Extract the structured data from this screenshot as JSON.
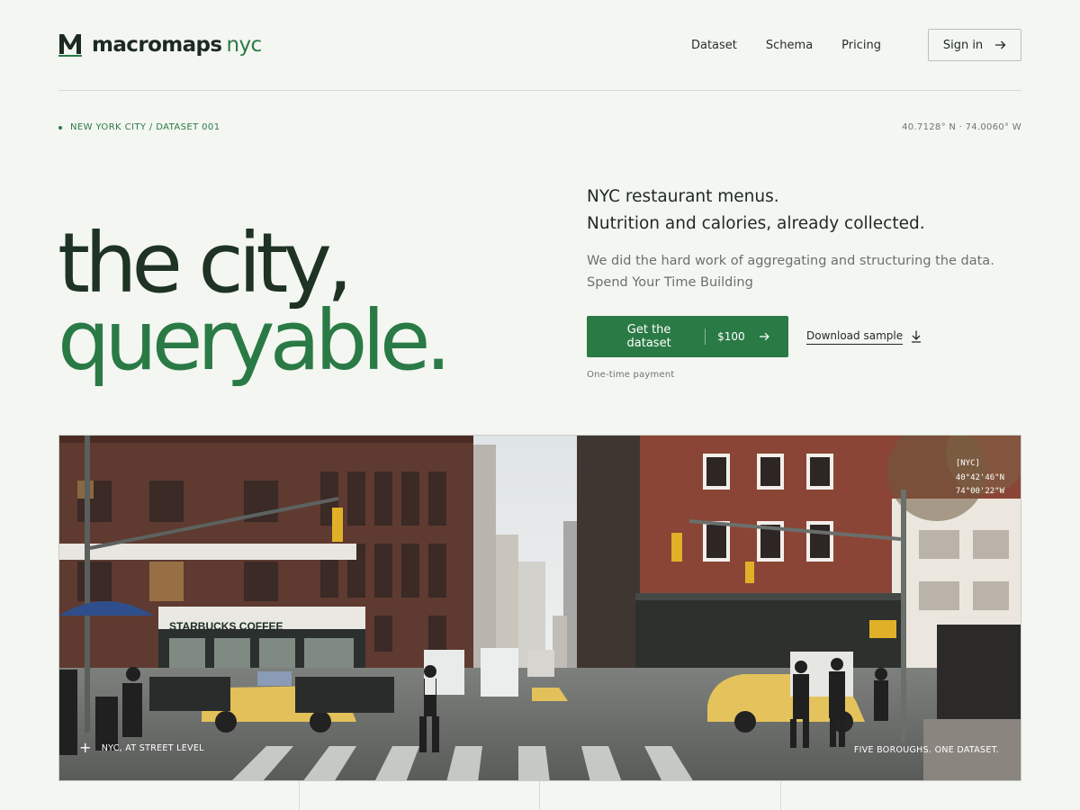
{
  "brand": {
    "name": "macromaps",
    "city": "nyc",
    "logo_letter": "M"
  },
  "nav": {
    "links": [
      "Dataset",
      "Schema",
      "Pricing"
    ],
    "signin_label": "Sign in"
  },
  "meta": {
    "breadcrumb": "NEW YORK CITY / DATASET 001",
    "coordinates": "40.7128° N · 74.0060° W"
  },
  "hero": {
    "line1": "the city,",
    "line2": "queryable."
  },
  "intro": {
    "lead_line1": "NYC restaurant menus.",
    "lead_line2": "Nutrition and calories, already collected.",
    "sub_line1": "We did the hard work of aggregating and structuring the data.",
    "sub_line2": "Spend Your Time Building"
  },
  "cta": {
    "primary_label": "Get the dataset",
    "price": "$100",
    "secondary_label": "Download sample",
    "note": "One-time payment"
  },
  "photo": {
    "overlay_tag": "[NYC]",
    "overlay_lat": "40°42'46\"N",
    "overlay_lon": "74°00'22\"W",
    "caption_left": "NYC, AT STREET LEVEL",
    "caption_right": "FIVE BOROUGHS. ONE DATASET.",
    "storefront_sign": "STARBUCKS COFFEE",
    "icons": [
      "plus-icon"
    ]
  },
  "colors": {
    "background": "#f4f6f1",
    "accent": "#2a7a46",
    "ink": "#1e2a22",
    "muted": "#6a716c",
    "border": "#d5dbd2"
  }
}
